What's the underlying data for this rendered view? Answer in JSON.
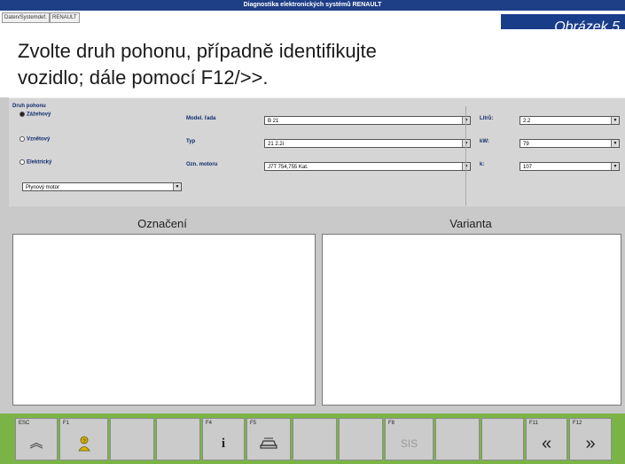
{
  "window": {
    "title": "Diagnostika elektronických systémů RENAULT"
  },
  "menu": {
    "items": [
      "Daten/Systemdef.",
      "RENAULT"
    ]
  },
  "badge": "Obrázek 5",
  "instruction": {
    "line1": "Zvolte druh pohonu, případně identifikujte",
    "line2": "vozidlo; dále pomocí F12/>>."
  },
  "drive": {
    "group_label": "Druh pohonu",
    "options": [
      {
        "label": "Zážehový",
        "selected": true
      },
      {
        "label": "Vznětový",
        "selected": false
      },
      {
        "label": "Elektrický",
        "selected": false
      }
    ],
    "gas_engine": "Plynový motor"
  },
  "fields": {
    "model_label": "Model. řada",
    "model_value": "B 21",
    "typ_label": "Typ",
    "typ_value": "21 2.2i",
    "engine_label": "Ozn. motoru",
    "engine_value": "J7T 754,755 Kat.",
    "litr_label": "Litrů:",
    "litr_value": "2.2",
    "kw_label": "kW:",
    "kw_value": "79",
    "k_label": "k:",
    "k_value": "107"
  },
  "columns": {
    "left": "Označení",
    "right": "Varianta"
  },
  "function_keys": {
    "esc": "ESC",
    "f1": "F1",
    "f4": "F4",
    "f5": "F5",
    "f8": "F8",
    "f8_text": "SIS",
    "f11": "F11",
    "f12": "F12",
    "esc_icon": "double-chevron-up-icon",
    "f1_icon": "help-person-icon",
    "f4_icon": "info-icon",
    "f5_icon": "vehicle-icon",
    "f11_icon": "double-chevron-left-icon",
    "f12_icon": "double-chevron-right-icon"
  }
}
